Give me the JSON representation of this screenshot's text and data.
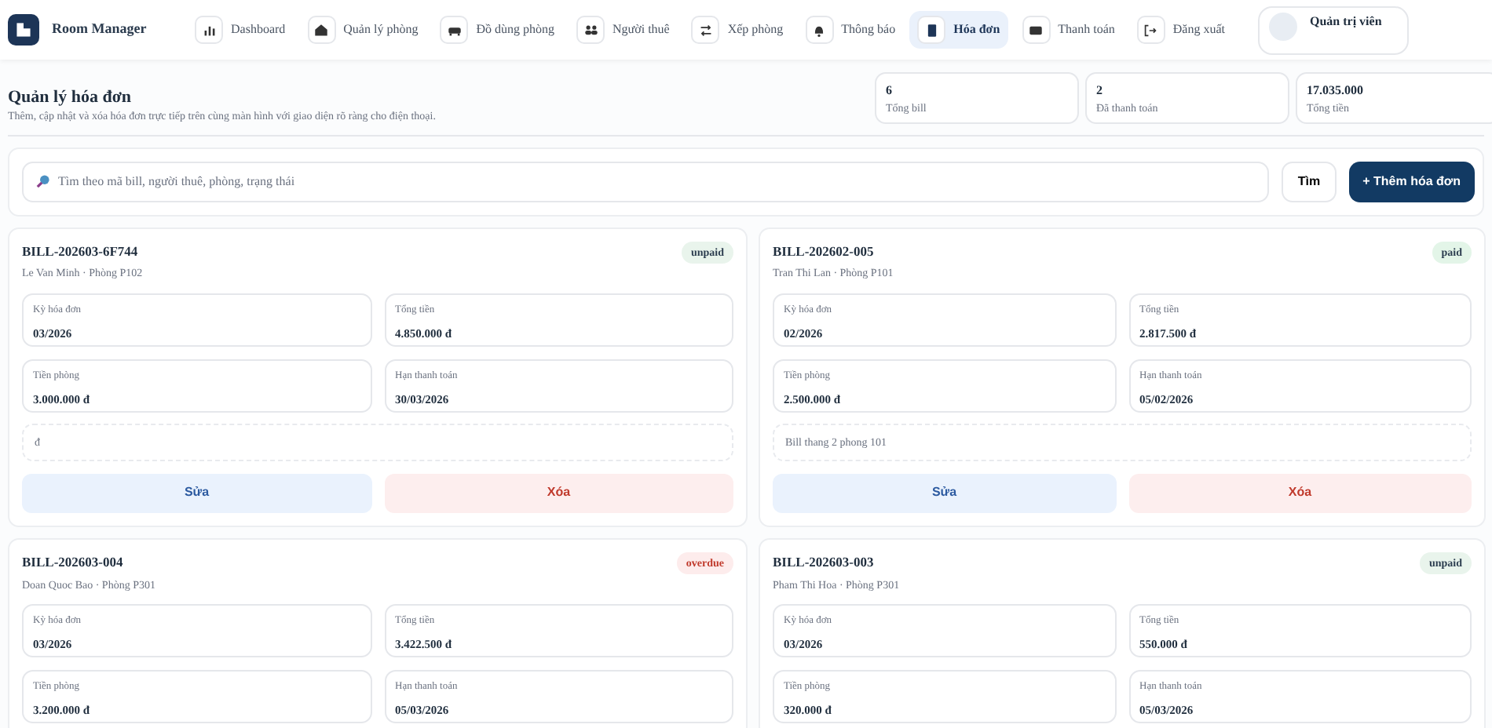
{
  "brand": {
    "title": "Room Manager"
  },
  "nav": [
    {
      "label": "Dashboard",
      "selected": false
    },
    {
      "label": "Quản lý phòng",
      "selected": false
    },
    {
      "label": "Đồ dùng phòng",
      "selected": false
    },
    {
      "label": "Người thuê",
      "selected": false
    },
    {
      "label": "Xếp phòng",
      "selected": false
    },
    {
      "label": "Thông báo",
      "selected": false
    },
    {
      "label": "Hóa đơn",
      "selected": true
    },
    {
      "label": "Thanh toán",
      "selected": false
    },
    {
      "label": "Đăng xuất",
      "selected": false
    }
  ],
  "user": {
    "role": "Quản trị viên"
  },
  "header": {
    "title": "Quản lý hóa đơn",
    "subtitle": "Thêm, cập nhật và xóa hóa đơn trực tiếp trên cùng màn hình với giao diện rõ ràng cho điện thoại."
  },
  "stats": [
    {
      "value": "6",
      "label": "Tổng bill"
    },
    {
      "value": "2",
      "label": "Đã thanh toán"
    },
    {
      "value": "17.035.000",
      "label": "Tổng tiền"
    }
  ],
  "search": {
    "placeholder": "Tìm theo mã bill, người thuê, phòng, trạng thái",
    "button": "Tìm",
    "add_button": "+ Thêm hóa đơn"
  },
  "bills": [
    {
      "code": "BILL-202603-6F744",
      "subtitle": "Le Van Minh · Phòng P102",
      "status": {
        "label": "unpaid",
        "kind": "pending"
      },
      "fields": [
        {
          "label": "Kỳ hóa đơn",
          "value": "03/2026"
        },
        {
          "label": "Tổng tiền",
          "value": "4.850.000 đ"
        },
        {
          "label": "Tiền phòng",
          "value": "3.000.000 đ"
        },
        {
          "label": "Hạn thanh toán",
          "value": "30/03/2026"
        }
      ],
      "note": "đ",
      "edit": "Sửa",
      "delete": "Xóa"
    },
    {
      "code": "BILL-202602-005",
      "subtitle": "Tran Thi Lan · Phòng P101",
      "status": {
        "label": "paid",
        "kind": "done"
      },
      "fields": [
        {
          "label": "Kỳ hóa đơn",
          "value": "02/2026"
        },
        {
          "label": "Tổng tiền",
          "value": "2.817.500 đ"
        },
        {
          "label": "Tiền phòng",
          "value": "2.500.000 đ"
        },
        {
          "label": "Hạn thanh toán",
          "value": "05/02/2026"
        }
      ],
      "note": "Bill thang 2 phong 101",
      "edit": "Sửa",
      "delete": "Xóa"
    },
    {
      "code": "BILL-202603-004",
      "subtitle": "Doan Quoc Bao · Phòng P301",
      "status": {
        "label": "overdue",
        "kind": "late"
      },
      "fields": [
        {
          "label": "Kỳ hóa đơn",
          "value": "03/2026"
        },
        {
          "label": "Tổng tiền",
          "value": "3.422.500 đ"
        },
        {
          "label": "Tiền phòng",
          "value": "3.200.000 đ"
        },
        {
          "label": "Hạn thanh toán",
          "value": "05/03/2026"
        }
      ]
    },
    {
      "code": "BILL-202603-003",
      "subtitle": "Pham Thi Hoa · Phòng P301",
      "status": {
        "label": "unpaid",
        "kind": "pending"
      },
      "fields": [
        {
          "label": "Kỳ hóa đơn",
          "value": "03/2026"
        },
        {
          "label": "Tổng tiền",
          "value": "550.000 đ"
        },
        {
          "label": "Tiền phòng",
          "value": "320.000 đ"
        },
        {
          "label": "Hạn thanh toán",
          "value": "05/03/2026"
        }
      ]
    }
  ]
}
